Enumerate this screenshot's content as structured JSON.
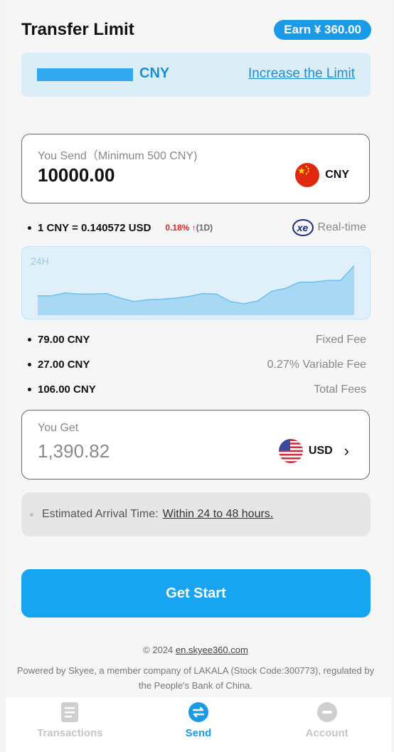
{
  "header": {
    "title": "Transfer Limit",
    "earn_badge": "Earn ¥ 360.00"
  },
  "limit": {
    "currency": "CNY",
    "increase_link": "Increase the Limit"
  },
  "send": {
    "label": "You Send（Minimum 500 CNY)",
    "amount": "10000.00",
    "currency": "CNY",
    "flag_icon": "china-flag-icon"
  },
  "rate": {
    "text": "1 CNY = 0.140572 USD",
    "change": "0.18%",
    "arrow": "↑",
    "period": "(1D)",
    "provider_logo": "xe",
    "provider_label": "Real-time"
  },
  "chart_data": {
    "type": "area",
    "label": "24H",
    "x": [
      0,
      1,
      2,
      3,
      4,
      5,
      6,
      7,
      8,
      9,
      10,
      11,
      12,
      13,
      14,
      15,
      16,
      17,
      18,
      19,
      20,
      21,
      22,
      23,
      24
    ],
    "values": [
      3.4,
      3.4,
      3.9,
      3.7,
      3.7,
      3.8,
      3.0,
      2.4,
      2.7,
      2.8,
      3.0,
      3.3,
      3.8,
      3.7,
      2.4,
      2.0,
      2.5,
      4.2,
      4.7,
      5.8,
      5.8,
      6.1,
      6.1,
      8.7
    ],
    "color": "#a9d8f4"
  },
  "fees": [
    {
      "value": "79.00 CNY",
      "label": "Fixed Fee"
    },
    {
      "value": "27.00 CNY",
      "label": "0.27% Variable Fee"
    },
    {
      "value": "106.00 CNY",
      "label": "Total Fees"
    }
  ],
  "receive": {
    "label": "You Get",
    "amount": "1,390.82",
    "currency": "USD",
    "flag_icon": "us-flag-icon"
  },
  "eta": {
    "prefix": "Estimated Arrival Time:",
    "value": "Within 24 to 48 hours."
  },
  "cta": {
    "label": "Get Start"
  },
  "footer": {
    "copyright": "© 2024",
    "site": "en.skyee360.com",
    "powered": "Powered by Skyee, a member company of LAKALA (Stock Code:300773), regulated by the People's Bank of China."
  },
  "tabs": [
    {
      "label": "Transactions",
      "icon": "transactions-icon"
    },
    {
      "label": "Send",
      "icon": "send-icon"
    },
    {
      "label": "Account",
      "icon": "account-icon"
    }
  ],
  "colors": {
    "accent": "#17a4f1",
    "up": "#e0262a"
  }
}
